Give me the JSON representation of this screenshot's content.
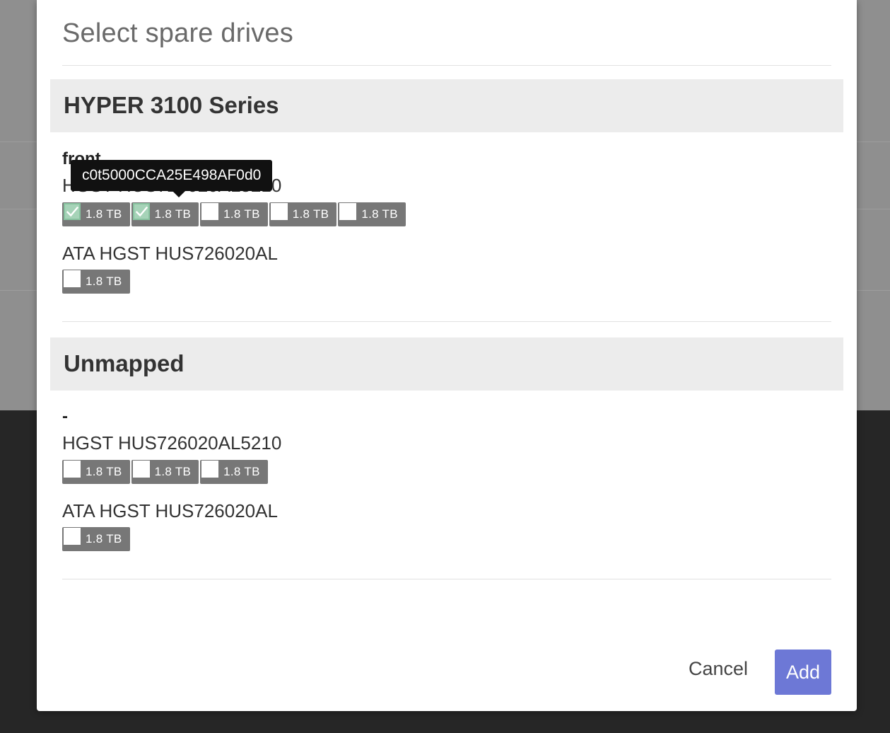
{
  "dialog": {
    "title": "Select spare drives",
    "cancel_label": "Cancel",
    "add_label": "Add",
    "accent_color": "#6d78d6",
    "check_color": "#88c4a0"
  },
  "tooltip": {
    "text": "c0t5000CCA25E498AF0d0"
  },
  "sections": [
    {
      "header": "HYPER 3100 Series",
      "location": "front",
      "groups": [
        {
          "model": "HGST HUS726020AL5210",
          "drives": [
            {
              "size": "1.8 TB",
              "checked": true
            },
            {
              "size": "1.8 TB",
              "checked": true
            },
            {
              "size": "1.8 TB",
              "checked": false
            },
            {
              "size": "1.8 TB",
              "checked": false
            },
            {
              "size": "1.8 TB",
              "checked": false
            }
          ]
        },
        {
          "model": "ATA HGST HUS726020AL",
          "drives": [
            {
              "size": "1.8 TB",
              "checked": false
            }
          ]
        }
      ]
    },
    {
      "header": "Unmapped",
      "location": "-",
      "groups": [
        {
          "model": "HGST HUS726020AL5210",
          "drives": [
            {
              "size": "1.8 TB",
              "checked": false
            },
            {
              "size": "1.8 TB",
              "checked": false
            },
            {
              "size": "1.8 TB",
              "checked": false
            }
          ]
        },
        {
          "model": "ATA HGST HUS726020AL",
          "drives": [
            {
              "size": "1.8 TB",
              "checked": false
            }
          ]
        }
      ]
    }
  ]
}
